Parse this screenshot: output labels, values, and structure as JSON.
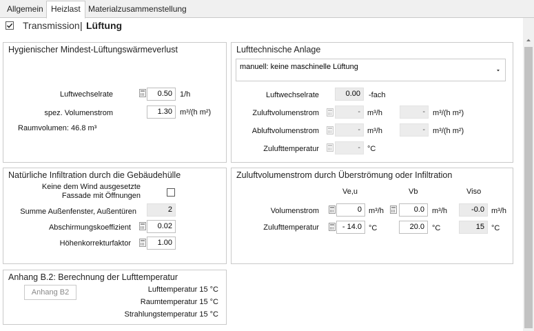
{
  "tabs": [
    {
      "label": "Allgemein"
    },
    {
      "label": "Heizlast"
    },
    {
      "label": "Materialzusammenstellung"
    }
  ],
  "subnav": {
    "transmission": "Transmission",
    "separator": "|",
    "lueftung": "Lüftung"
  },
  "hyg": {
    "title": "Hygienischer Mindest-Lüftungswärmeverlust",
    "luftwechselrate_label": "Luftwechselrate",
    "luftwechselrate_value": "0.50",
    "luftwechselrate_unit": "1/h",
    "spez_label": "spez. Volumenstrom",
    "spez_value": "1.30",
    "spez_unit": "m³/(h m²)",
    "raumvolumen": "Raumvolumen: 46.8 m³"
  },
  "luft": {
    "title": "Lufttechnische Anlage",
    "select_value": "manuell: keine maschinelle Lüftung",
    "lw_label": "Luftwechselrate",
    "lw_value": "0.00",
    "lw_unit": "-fach",
    "zu_label": "Zuluftvolumenstrom",
    "zu_value": "-",
    "zu_unit": "m³/h",
    "zu_value2": "-",
    "zu_unit2": "m³/(h m²)",
    "ab_label": "Abluftvolumenstrom",
    "ab_value": "-",
    "ab_unit": "m³/h",
    "ab_value2": "-",
    "ab_unit2": "m³/(h m²)",
    "temp_label": "Zulufttemperatur",
    "temp_value": "-",
    "temp_unit": "°C"
  },
  "nat": {
    "title": "Natürliche Infiltration durch die Gebäudehülle",
    "wind_line1": "Keine dem Wind ausgesetzte",
    "wind_line2": "Fassade mit Öffnungen",
    "summe_label": "Summe Außenfenster, Außentüren",
    "summe_value": "2",
    "abschirm_label": "Abschirmungskoeffizient",
    "abschirm_value": "0.02",
    "hoehe_label": "Höhenkorrekturfaktor",
    "hoehe_value": "1.00"
  },
  "zuv": {
    "title": "Zuluftvolumenstrom durch Überströmung oder Infiltration",
    "col_veu": "Ve,u",
    "col_vb": "Vb",
    "col_viso": "Viso",
    "vol_label": "Volumenstrom",
    "vol_veu": "0",
    "vol_veu_unit": "m³/h",
    "vol_vb": "0.0",
    "vol_vb_unit": "m³/h",
    "vol_viso": "-0.0",
    "vol_viso_unit": "m³/h",
    "temp_label": "Zulufttemperatur",
    "temp_veu": "- 14.0",
    "temp_veu_unit": "°C",
    "temp_vb": "20.0",
    "temp_vb_unit": "°C",
    "temp_viso": "15",
    "temp_viso_unit": "°C"
  },
  "anhang": {
    "title": "Anhang B.2: Berechnung der Lufttemperatur",
    "button": "Anhang B2",
    "line1": "Lufttemperatur 15 °C",
    "line2": "Raumtemperatur 15 °C",
    "line3": "Strahlungstemperatur 15 °C"
  },
  "colors": {
    "tab_bg": "#f0f0f0",
    "border": "#c9c9c9",
    "readonly_bg": "#ebebeb",
    "scrollbar_thumb": "#c2c2c2"
  }
}
